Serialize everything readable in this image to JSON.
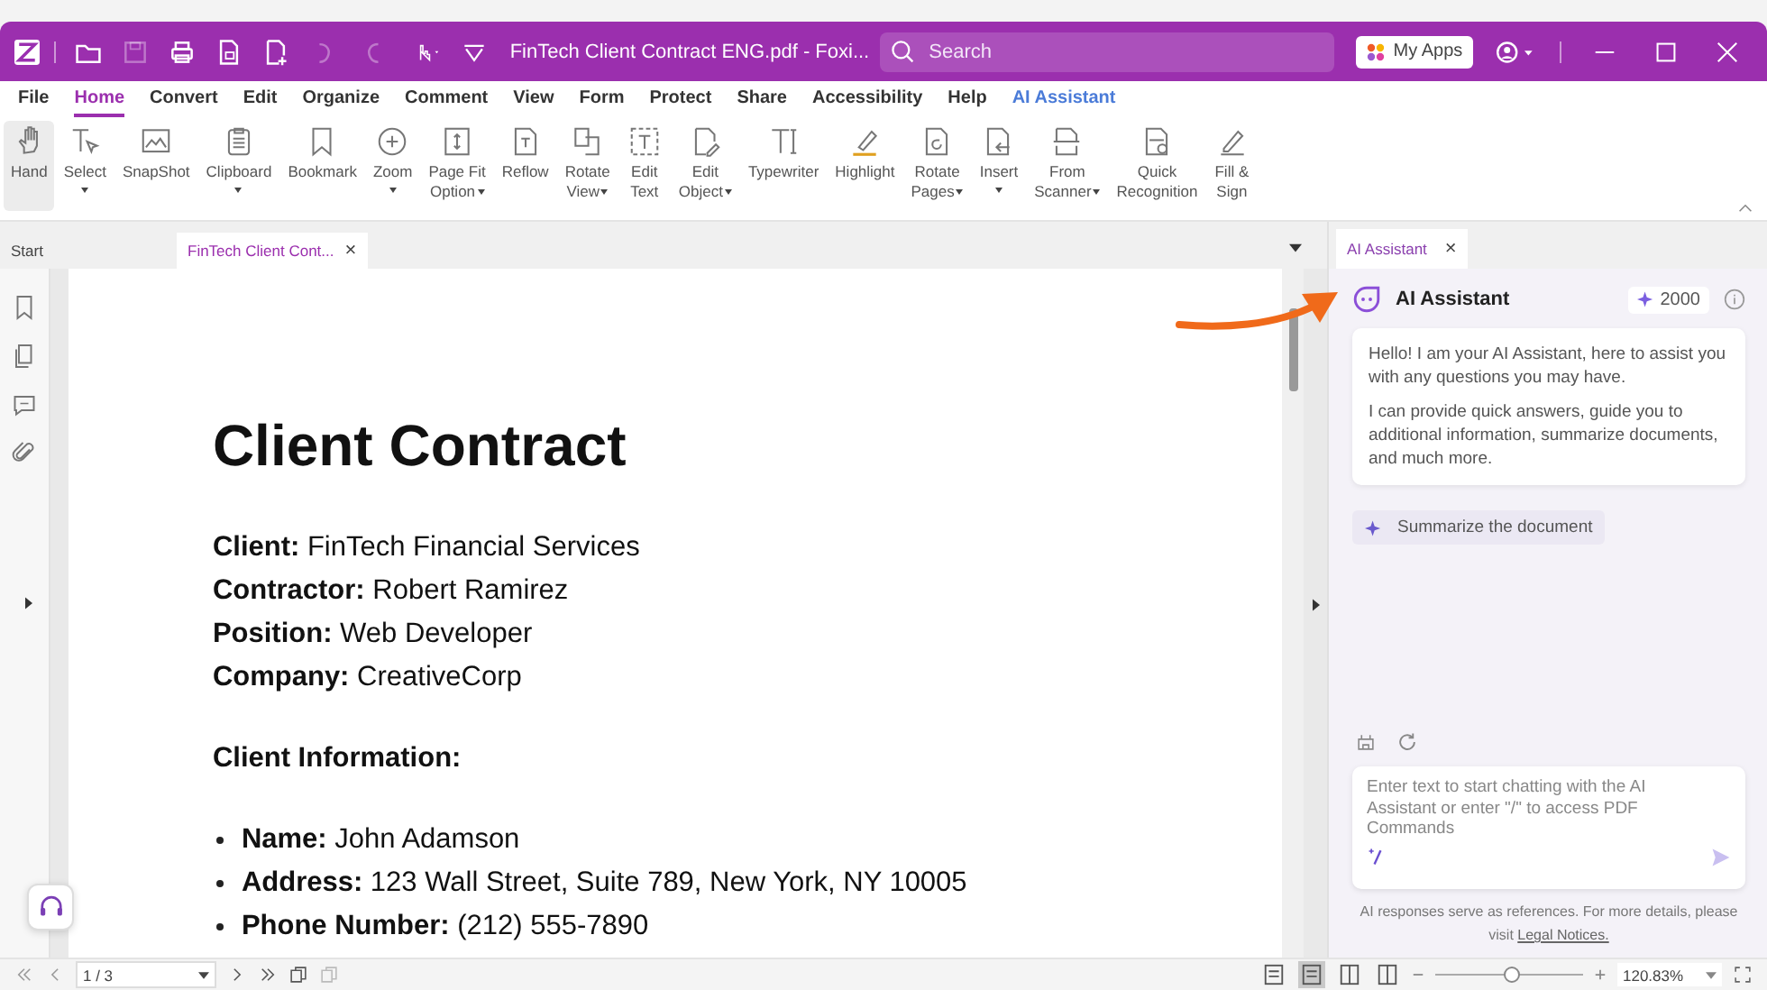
{
  "title_bar": {
    "title": "FinTech Client Contract ENG.pdf - Foxi...",
    "search": {
      "placeholder": "Search"
    },
    "apps_button": "My Apps"
  },
  "quick_access": [
    {
      "disabled": false
    },
    {
      "disabled": true
    },
    {
      "disabled": false
    },
    {
      "disabled": false
    },
    {
      "disabled": false
    },
    {
      "disabled": true
    },
    {
      "disabled": true
    }
  ],
  "menu": [
    {
      "label": "File",
      "selected": false,
      "accent": false
    },
    {
      "label": "Home",
      "selected": true,
      "accent": false
    },
    {
      "label": "Convert",
      "selected": false,
      "accent": false
    },
    {
      "label": "Edit",
      "selected": false,
      "accent": false
    },
    {
      "label": "Organize",
      "selected": false,
      "accent": false
    },
    {
      "label": "Comment",
      "selected": false,
      "accent": false
    },
    {
      "label": "View",
      "selected": false,
      "accent": false
    },
    {
      "label": "Form",
      "selected": false,
      "accent": false
    },
    {
      "label": "Protect",
      "selected": false,
      "accent": false
    },
    {
      "label": "Share",
      "selected": false,
      "accent": false
    },
    {
      "label": "Accessibility",
      "selected": false,
      "accent": false
    },
    {
      "label": "Help",
      "selected": false,
      "accent": false
    },
    {
      "label": "AI Assistant",
      "selected": false,
      "accent": true
    }
  ],
  "ribbon": [
    {
      "lines": [
        "Hand"
      ],
      "dropdown": false,
      "selected": true
    },
    {
      "lines": [
        "Select"
      ],
      "dropdown": true,
      "selected": false
    },
    {
      "lines": [
        "SnapShot"
      ],
      "dropdown": false,
      "selected": false
    },
    {
      "lines": [
        "Clipboard"
      ],
      "dropdown": true,
      "selected": false
    },
    {
      "lines": [
        "Bookmark"
      ],
      "dropdown": false,
      "selected": false
    },
    {
      "lines": [
        "Zoom"
      ],
      "dropdown": true,
      "selected": false
    },
    {
      "lines": [
        "Page Fit",
        "Option"
      ],
      "dropdown": true,
      "selected": false
    },
    {
      "lines": [
        "Reflow"
      ],
      "dropdown": false,
      "selected": false
    },
    {
      "lines": [
        "Rotate",
        "View"
      ],
      "dropdown": true,
      "selected": false
    },
    {
      "lines": [
        "Edit",
        "Text"
      ],
      "dropdown": false,
      "selected": false
    },
    {
      "lines": [
        "Edit",
        "Object"
      ],
      "dropdown": true,
      "selected": false
    },
    {
      "lines": [
        "Typewriter"
      ],
      "dropdown": false,
      "selected": false
    },
    {
      "lines": [
        "Highlight"
      ],
      "dropdown": false,
      "selected": false
    },
    {
      "lines": [
        "Rotate",
        "Pages"
      ],
      "dropdown": true,
      "selected": false
    },
    {
      "lines": [
        "Insert"
      ],
      "dropdown": true,
      "selected": false
    },
    {
      "lines": [
        "From",
        "Scanner"
      ],
      "dropdown": true,
      "selected": false
    },
    {
      "lines": [
        "Quick",
        "Recognition"
      ],
      "dropdown": false,
      "selected": false
    },
    {
      "lines": [
        "Fill &",
        "Sign"
      ],
      "dropdown": false,
      "selected": false
    }
  ],
  "document_tabs": [
    {
      "label": "Start",
      "selected": false
    },
    {
      "label": "FinTech Client Cont...",
      "selected": true,
      "close": "×"
    }
  ],
  "document": {
    "title": "Client Contract",
    "fields": [
      "**Client:** FinTech Financial Services",
      "**Contractor:** Robert Ramirez",
      "**Position:** Web Developer",
      "**Company:** CreativeCorp"
    ],
    "section": "Client Information:",
    "bullets": [
      "**Name:** John Adamson",
      "**Address:** 123 Wall Street, Suite 789, New York, NY 10005",
      "**Phone Number:** (212) 555-7890"
    ]
  },
  "assistant": {
    "tab": "AI Assistant",
    "tab_close": "×",
    "title": "AI Assistant",
    "credits": "2000",
    "messages": [
      "Hello! I am your AI Assistant, here to assist you with any questions you may have.",
      "I can provide quick answers, guide you to additional information, summarize documents, and much more."
    ],
    "suggestion": "Summarize the document",
    "input": {
      "placeholder": "Enter text to start chatting with the AI Assistant or enter \"/\" to access PDF Commands"
    },
    "disclaimer": "AI responses serve as references. For more details, please visit",
    "link": "Legal Notices."
  },
  "status_bar": {
    "page": "1 / 3",
    "view_modes": [
      {
        "selected": false
      },
      {
        "selected": true
      },
      {
        "selected": false
      },
      {
        "selected": false
      }
    ],
    "zoom": {
      "level": 0.52,
      "value": "120.83%"
    }
  }
}
